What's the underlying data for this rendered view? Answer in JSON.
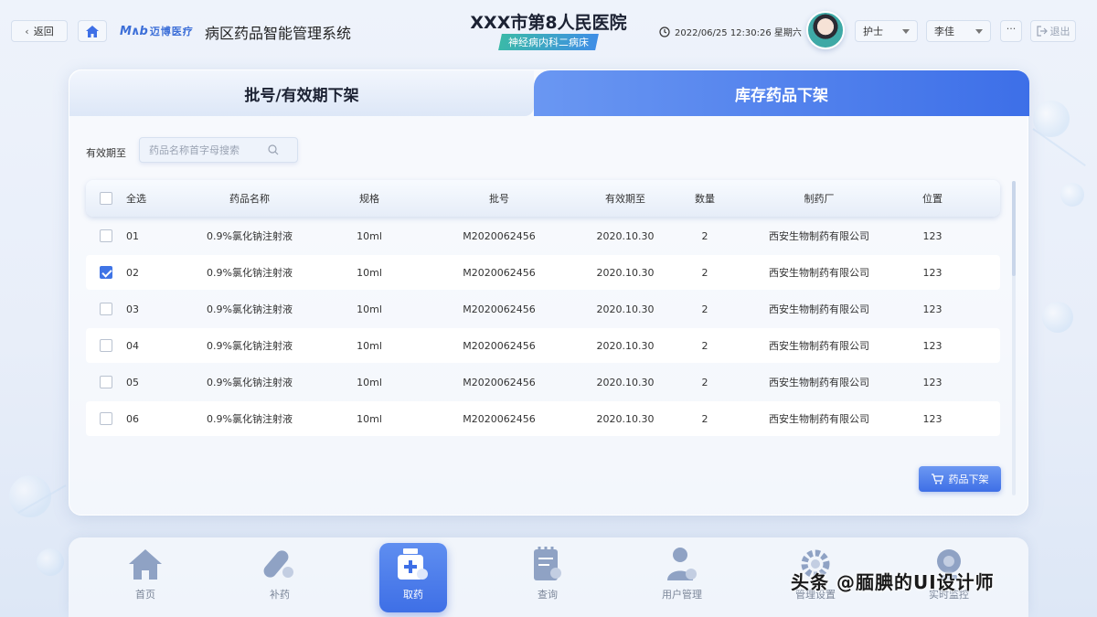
{
  "header": {
    "back_label": "返回",
    "logo_mark": "M∧b",
    "logo_text": "迈博医疗",
    "system_title": "病区药品智能管理系统",
    "hospital_title": "XXX市第8人民医院",
    "ward": "神经病内科二病床",
    "datetime": "2022/06/25 12:30:26 星期六",
    "role_select": "护士",
    "user_select": "李佳",
    "more_label": "···",
    "logout_label": "退出"
  },
  "tabs": {
    "left": "批号/有效期下架",
    "right": "库存药品下架"
  },
  "filter": {
    "label": "有效期至",
    "search_placeholder": "药品名称首字母搜索"
  },
  "table": {
    "headers": {
      "select_all": "全选",
      "name": "药品名称",
      "spec": "规格",
      "batch": "批号",
      "expiry": "有效期至",
      "qty": "数量",
      "manufacturer": "制药厂",
      "position": "位置"
    },
    "rows": [
      {
        "idx": "01",
        "name": "0.9%氯化钠注射液",
        "spec": "10ml",
        "batch": "M2020062456",
        "expiry": "2020.10.30",
        "qty": "2",
        "mfr": "西安生物制药有限公司",
        "pos": "123",
        "checked": false
      },
      {
        "idx": "02",
        "name": "0.9%氯化钠注射液",
        "spec": "10ml",
        "batch": "M2020062456",
        "expiry": "2020.10.30",
        "qty": "2",
        "mfr": "西安生物制药有限公司",
        "pos": "123",
        "checked": true
      },
      {
        "idx": "03",
        "name": "0.9%氯化钠注射液",
        "spec": "10ml",
        "batch": "M2020062456",
        "expiry": "2020.10.30",
        "qty": "2",
        "mfr": "西安生物制药有限公司",
        "pos": "123",
        "checked": false
      },
      {
        "idx": "04",
        "name": "0.9%氯化钠注射液",
        "spec": "10ml",
        "batch": "M2020062456",
        "expiry": "2020.10.30",
        "qty": "2",
        "mfr": "西安生物制药有限公司",
        "pos": "123",
        "checked": false
      },
      {
        "idx": "05",
        "name": "0.9%氯化钠注射液",
        "spec": "10ml",
        "batch": "M2020062456",
        "expiry": "2020.10.30",
        "qty": "2",
        "mfr": "西安生物制药有限公司",
        "pos": "123",
        "checked": false
      },
      {
        "idx": "06",
        "name": "0.9%氯化钠注射液",
        "spec": "10ml",
        "batch": "M2020062456",
        "expiry": "2020.10.30",
        "qty": "2",
        "mfr": "西安生物制药有限公司",
        "pos": "123",
        "checked": false
      }
    ]
  },
  "action": {
    "offshelf_label": "药品下架"
  },
  "nav": {
    "items": [
      {
        "label": "首页",
        "icon": "home-icon",
        "active": false
      },
      {
        "label": "补药",
        "icon": "pill-icon",
        "active": false
      },
      {
        "label": "取药",
        "icon": "medicine-box-icon",
        "active": true
      },
      {
        "label": "查询",
        "icon": "clipboard-search-icon",
        "active": false
      },
      {
        "label": "用户管理",
        "icon": "user-settings-icon",
        "active": false
      },
      {
        "label": "管理设置",
        "icon": "gear-icon",
        "active": false
      },
      {
        "label": "实时监控",
        "icon": "monitor-icon",
        "active": false
      }
    ]
  },
  "watermark": "头条 @腼腆的UI设计师",
  "colors": {
    "accent": "#3e6fe6",
    "ward_badge": "#3bb9a8"
  }
}
